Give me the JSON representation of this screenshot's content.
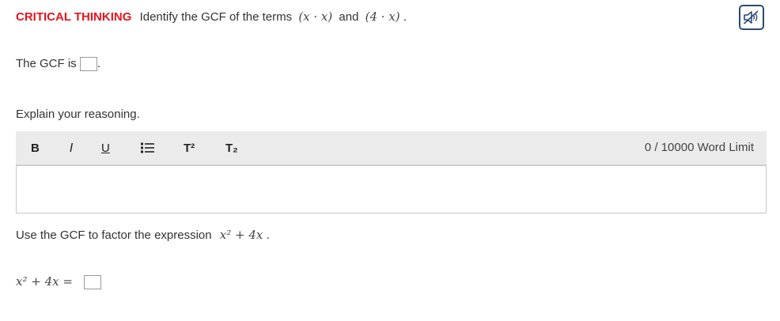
{
  "question": {
    "label": "CRITICAL THINKING",
    "text": "Identify the GCF of the terms",
    "term1": "(x · x)",
    "connector": "and",
    "term2": "(4 · x)",
    "end": "."
  },
  "gcf": {
    "label": "The GCF is",
    "end": "."
  },
  "explain": {
    "prompt": "Explain your reasoning."
  },
  "toolbar": {
    "bold": "B",
    "italic": "I",
    "underline": "U",
    "superscript": "T²",
    "subscript": "T₂",
    "word_limit": "0 / 10000 Word Limit"
  },
  "factor": {
    "prompt": "Use the GCF to factor the expression",
    "expression": "x² + 4x",
    "end": ".",
    "equation_lhs": "x² + 4x ="
  },
  "colors": {
    "accent_red": "#e8141c",
    "toolbar_bg": "#ebebeb",
    "audio_icon": "#2a4a72"
  },
  "icons": {
    "audio": "speaker-muted-icon",
    "list": "bulleted-list-icon"
  }
}
